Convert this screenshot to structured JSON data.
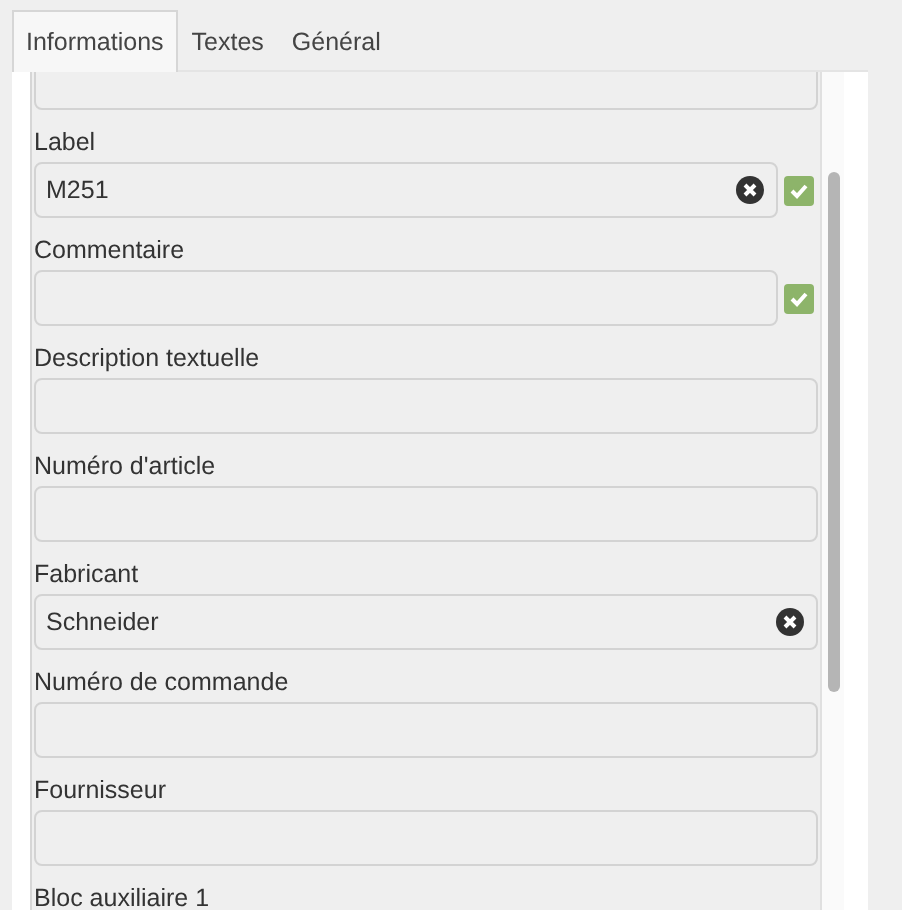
{
  "tabs": [
    {
      "label": "Informations",
      "selected": true
    },
    {
      "label": "Textes",
      "selected": false
    },
    {
      "label": "Général",
      "selected": false
    }
  ],
  "fields": [
    {
      "label": "Label",
      "value": "M251",
      "clearable": true,
      "validated": true
    },
    {
      "label": "Commentaire",
      "clearable": false,
      "validated": true
    },
    {
      "label": "Description textuelle",
      "clearable": false,
      "validated": false
    },
    {
      "label": "Numéro d'article",
      "clearable": false,
      "validated": false
    },
    {
      "label": "Fabricant",
      "value": "Schneider",
      "clearable": true,
      "validated": false
    },
    {
      "label": "Numéro de commande",
      "clearable": false,
      "validated": false
    },
    {
      "label": "Fournisseur",
      "clearable": false,
      "validated": false
    },
    {
      "label": "Bloc auxiliaire 1"
    }
  ]
}
